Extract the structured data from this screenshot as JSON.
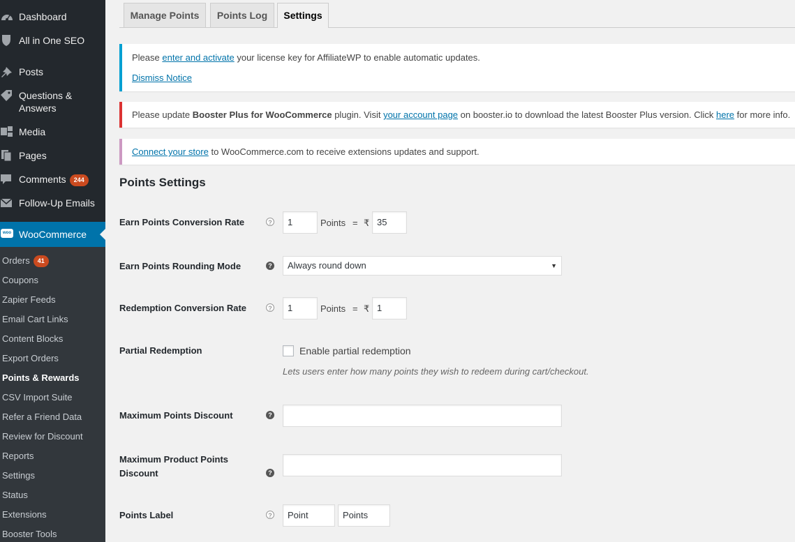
{
  "sidebar": {
    "top_items": [
      {
        "label": "Dashboard",
        "icon": "dashboard-icon"
      },
      {
        "label": "All in One SEO",
        "icon": "shield-icon"
      },
      {
        "label": "Posts",
        "icon": "pin-icon"
      },
      {
        "label": "Questions &",
        "label2": "Answers",
        "icon": "tag-icon"
      },
      {
        "label": "Media",
        "icon": "media-icon"
      },
      {
        "label": "Pages",
        "icon": "pages-icon"
      },
      {
        "label": "Comments",
        "badge": "244",
        "icon": "comment-icon"
      },
      {
        "label": "Follow-Up Emails",
        "icon": "email-icon"
      }
    ],
    "woocommerce": {
      "label": "WooCommerce",
      "icon_text": "woo"
    },
    "submenu": [
      {
        "label": "Orders",
        "badge": "41"
      },
      {
        "label": "Coupons"
      },
      {
        "label": "Zapier Feeds"
      },
      {
        "label": "Email Cart Links"
      },
      {
        "label": "Content Blocks"
      },
      {
        "label": "Export Orders"
      },
      {
        "label": "Points & Rewards",
        "current": true
      },
      {
        "label": "CSV Import Suite"
      },
      {
        "label": "Refer a Friend Data"
      },
      {
        "label": "Review for Discount"
      },
      {
        "label": "Reports"
      },
      {
        "label": "Settings"
      },
      {
        "label": "Status"
      },
      {
        "label": "Extensions"
      },
      {
        "label": "Booster Tools"
      }
    ]
  },
  "tabs": [
    {
      "label": "Manage Points"
    },
    {
      "label": "Points Log"
    },
    {
      "label": "Settings",
      "active": true
    }
  ],
  "notices": {
    "affiliate": {
      "pre": "Please ",
      "link": "enter and activate",
      "post": " your license key for AffiliateWP to enable automatic updates.",
      "dismiss": "Dismiss Notice",
      "color": "#00a0d2"
    },
    "booster": {
      "pre": "Please update ",
      "bold": "Booster Plus for WooCommerce",
      "mid1": " plugin. Visit ",
      "link1": "your account page",
      "mid2": " on booster.io to download the latest Booster Plus version. Click ",
      "link2": "here",
      "post": " for more info.",
      "color": "#dc3232"
    },
    "woo": {
      "link": "Connect your store",
      "post": " to WooCommerce.com to receive extensions updates and support.",
      "color": "#cc99c2"
    }
  },
  "settings": {
    "title": "Points Settings",
    "earn_rate": {
      "label": "Earn Points Conversion Rate",
      "points": "1",
      "points_text": "Points",
      "equals": "=",
      "currency": "₹",
      "value": "35"
    },
    "rounding": {
      "label": "Earn Points Rounding Mode",
      "value": "Always round down"
    },
    "redemption_rate": {
      "label": "Redemption Conversion Rate",
      "points": "1",
      "points_text": "Points",
      "equals": "=",
      "currency": "₹",
      "value": "1"
    },
    "partial": {
      "label": "Partial Redemption",
      "checkbox_label": "Enable partial redemption",
      "checked": false,
      "description": "Lets users enter how many points they wish to redeem during cart/checkout."
    },
    "max_discount": {
      "label": "Maximum Points Discount",
      "value": ""
    },
    "max_product_discount": {
      "label": "Maximum Product Points",
      "label2": "Discount",
      "value": ""
    },
    "points_label": {
      "label": "Points Label",
      "singular": "Point",
      "plural": "Points"
    }
  }
}
